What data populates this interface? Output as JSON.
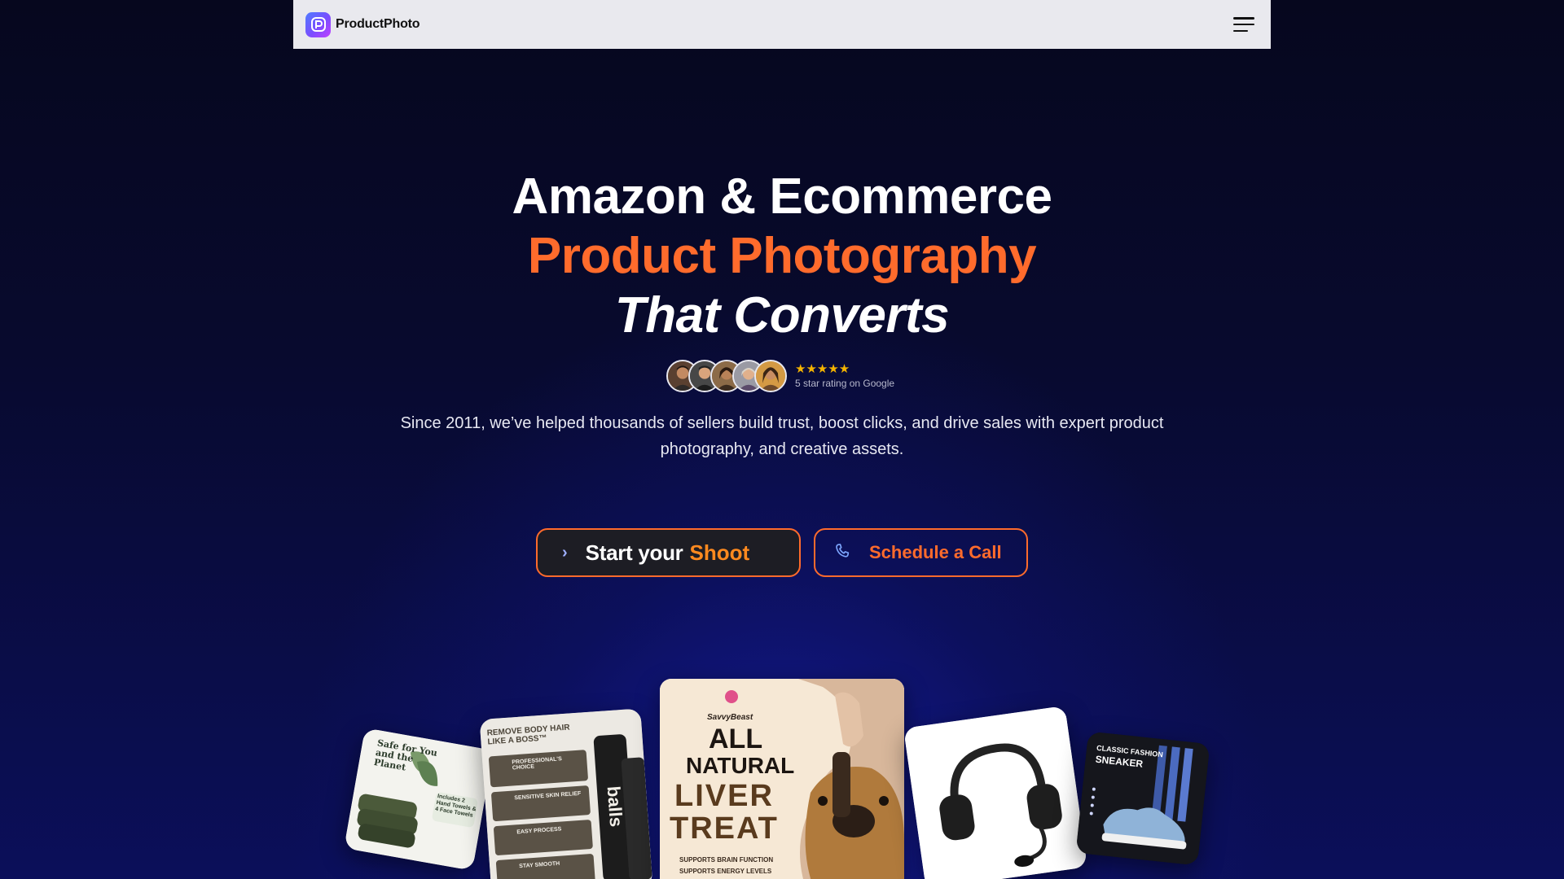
{
  "navbar": {
    "brand_name": "ProductPhoto",
    "logo_icon": "productphoto-logo-icon",
    "menu_icon": "hamburger-menu-icon"
  },
  "hero": {
    "title_line1": "Amazon & Ecommerce",
    "title_line2": "Product Photography",
    "title_line3": "That Converts",
    "stars": "★★★★★",
    "rating_text": "5 star rating on Google",
    "subtext": "Since 2011, we’ve helped thousands of sellers build trust, boost clicks, and drive sales with expert product photography, and creative assets."
  },
  "cta": {
    "primary_label": "Start your",
    "primary_accent": "Shoot",
    "primary_icon": "chevron-right-icon",
    "secondary_label": "Schedule a Call",
    "secondary_icon": "phone-icon"
  },
  "gallery": {
    "towels": {
      "title": "Safe for You and the Planet",
      "badge": "Includes 2 Hand Towels & 4 Face Towels"
    },
    "balls": {
      "title": "REMOVE BODY HAIR LIKE A BOSS™",
      "item1": "PROFESSIONAL'S CHOICE",
      "item2": "SENSITIVE SKIN RELIEF",
      "item3": "EASY PROCESS",
      "item4": "STAY SMOOTH",
      "product": "balls"
    },
    "treat": {
      "brand": "SavvyBeast",
      "line1": "ALL",
      "line2": "NATURAL",
      "line3": "LIVER",
      "line4": "TREAT",
      "bullet1": "SUPPORTS BRAIN FUNCTION",
      "bullet2": "SUPPORTS ENERGY LEVELS"
    },
    "sneaker": {
      "title1": "CLASSIC FASHION",
      "title2": "SNEAKER"
    }
  },
  "colors": {
    "accent_orange": "#ff6b2c",
    "star_gold": "#f5b400",
    "navbar_bg": "#e9e9ee",
    "page_bg": "#06071e"
  }
}
